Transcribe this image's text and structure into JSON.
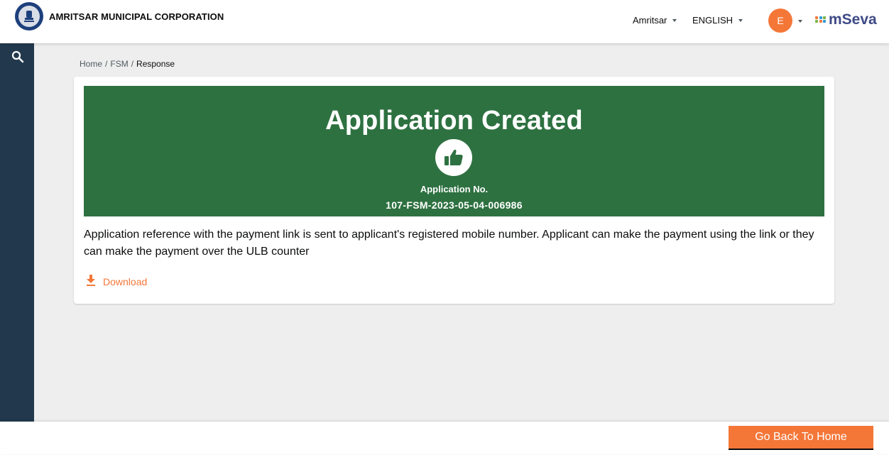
{
  "header": {
    "org_name": "AMRITSAR MUNICIPAL CORPORATION",
    "city": "Amritsar",
    "language": "ENGLISH",
    "avatar_initial": "E",
    "brand": "mSeva",
    "brand_color": "#3e4a87",
    "accent_color": "#f47738"
  },
  "sidebar": {
    "icon": "search-icon",
    "color": "#22394d"
  },
  "breadcrumb": {
    "home": "Home",
    "sep1": "/",
    "fsm": "FSM",
    "sep2": "/",
    "current": "Response"
  },
  "banner": {
    "title": "Application Created",
    "icon": "thumbs-up-icon",
    "label": "Application No.",
    "number": "107-FSM-2023-05-04-006986",
    "color": "#2e7141"
  },
  "message": "Application reference with the payment link is sent to applicant's registered mobile number. Applicant can make the payment using the link or they can make the payment over the ULB counter",
  "download": {
    "label": "Download",
    "icon": "download-icon"
  },
  "footer": {
    "go_back_label": "Go Back To Home"
  }
}
